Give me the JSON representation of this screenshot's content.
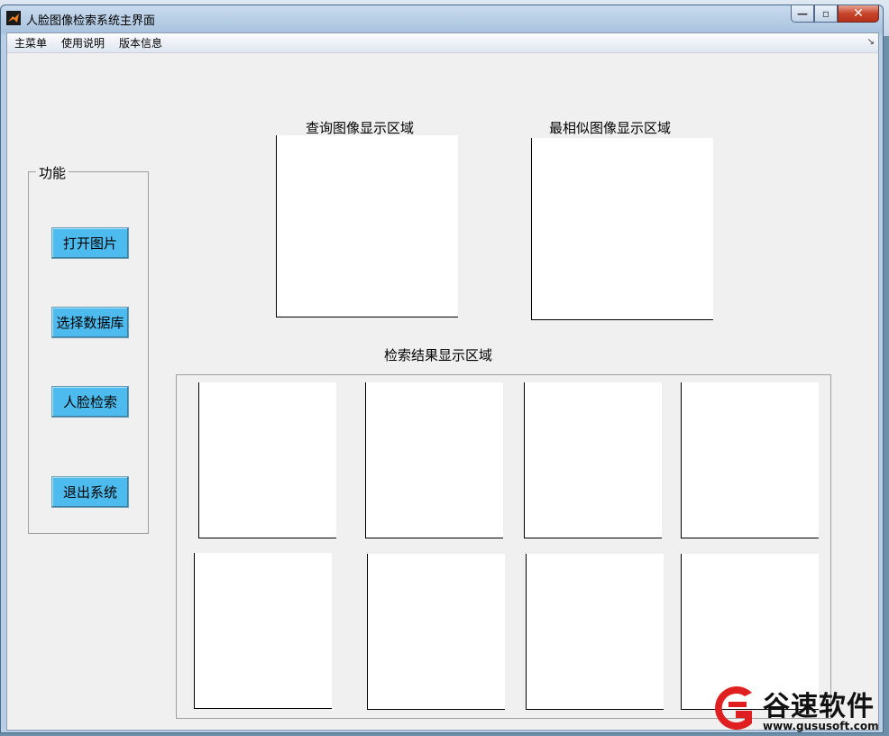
{
  "window": {
    "title": "人脸图像检索系统主界面",
    "controls": {
      "minimize": "—",
      "maximize": "▫",
      "close": "✕"
    }
  },
  "menubar": {
    "items": [
      "主菜单",
      "使用说明",
      "版本信息"
    ],
    "overflow_arrow": "↘"
  },
  "function_panel": {
    "title": "功能",
    "buttons": [
      "打开图片",
      "选择数据库",
      "人脸检索",
      "退出系统"
    ],
    "button_color": "#4dbbee"
  },
  "query_area": {
    "label": "查询图像显示区域"
  },
  "most_similar_area": {
    "label": "最相似图像显示区域"
  },
  "results_area": {
    "label": "检索结果显示区域",
    "slot_count": 8
  },
  "watermark": {
    "brand": "谷速软件",
    "url": "www.gususoft.com",
    "logo_color": "#e02020"
  },
  "icons": {
    "app": "matlab-icon",
    "logo": "gusu-logo-icon"
  }
}
